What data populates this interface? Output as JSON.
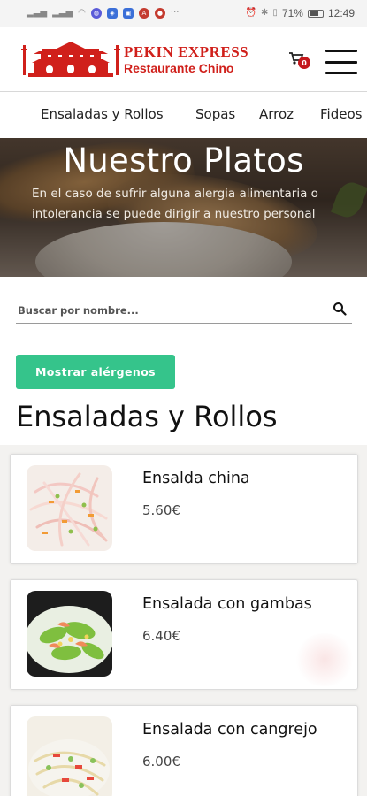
{
  "status_bar": {
    "battery": "71%",
    "time": "12:49",
    "battery_level": 0.71
  },
  "brand": {
    "title": "PEKIN EXPRESS",
    "subtitle": "Restaurante Chino",
    "color": "#d0201b"
  },
  "cart": {
    "count": "0",
    "icon": "cart-icon"
  },
  "menu_icon": "hamburger-menu-icon",
  "categories": [
    {
      "label": "Ensaladas y Rollos"
    },
    {
      "label": "Sopas"
    },
    {
      "label": "Arroz"
    },
    {
      "label": "Fideos"
    }
  ],
  "hero": {
    "title": "Nuestro Platos",
    "description": "En el caso de sufrir alguna alergia alimentaria o intolerancia se puede dirigir a nuestro personal"
  },
  "search": {
    "placeholder": "Buscar por nombre...",
    "value": "",
    "icon": "search-icon"
  },
  "allergens_button": {
    "label": "Mostrar alérgenos",
    "color": "#35c48b"
  },
  "section": {
    "title": "Ensaladas y Rollos"
  },
  "dishes": [
    {
      "name": "Ensalda china",
      "price": "5.60€",
      "image": "salad-shredded-image"
    },
    {
      "name": "Ensalada con gambas",
      "price": "6.40€",
      "image": "salad-shrimp-image"
    },
    {
      "name": "Ensalada con cangrejo",
      "price": "6.00€",
      "image": "salad-crab-image"
    }
  ]
}
